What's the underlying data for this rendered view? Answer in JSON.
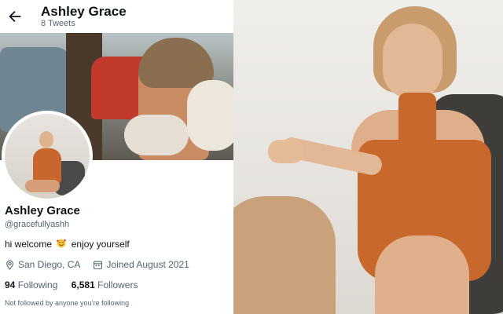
{
  "header": {
    "display_name": "Ashley Grace",
    "tweet_count": "8 Tweets",
    "back_icon": "arrow-left-icon"
  },
  "profile": {
    "display_name": "Ashley Grace",
    "handle": "@gracefullyashh",
    "bio_before": "hi welcome",
    "bio_emoji": "smiling-face-with-hearts",
    "bio_after": "enjoy yourself",
    "location": "San Diego, CA",
    "joined": "Joined August 2021",
    "following_count": "94",
    "following_label": "Following",
    "followers_count": "6,581",
    "followers_label": "Followers",
    "not_followed": "Not followed by anyone you’re following"
  },
  "colors": {
    "text_primary": "#0f1419",
    "text_secondary": "#536471",
    "dress_orange": "#c8682d"
  }
}
